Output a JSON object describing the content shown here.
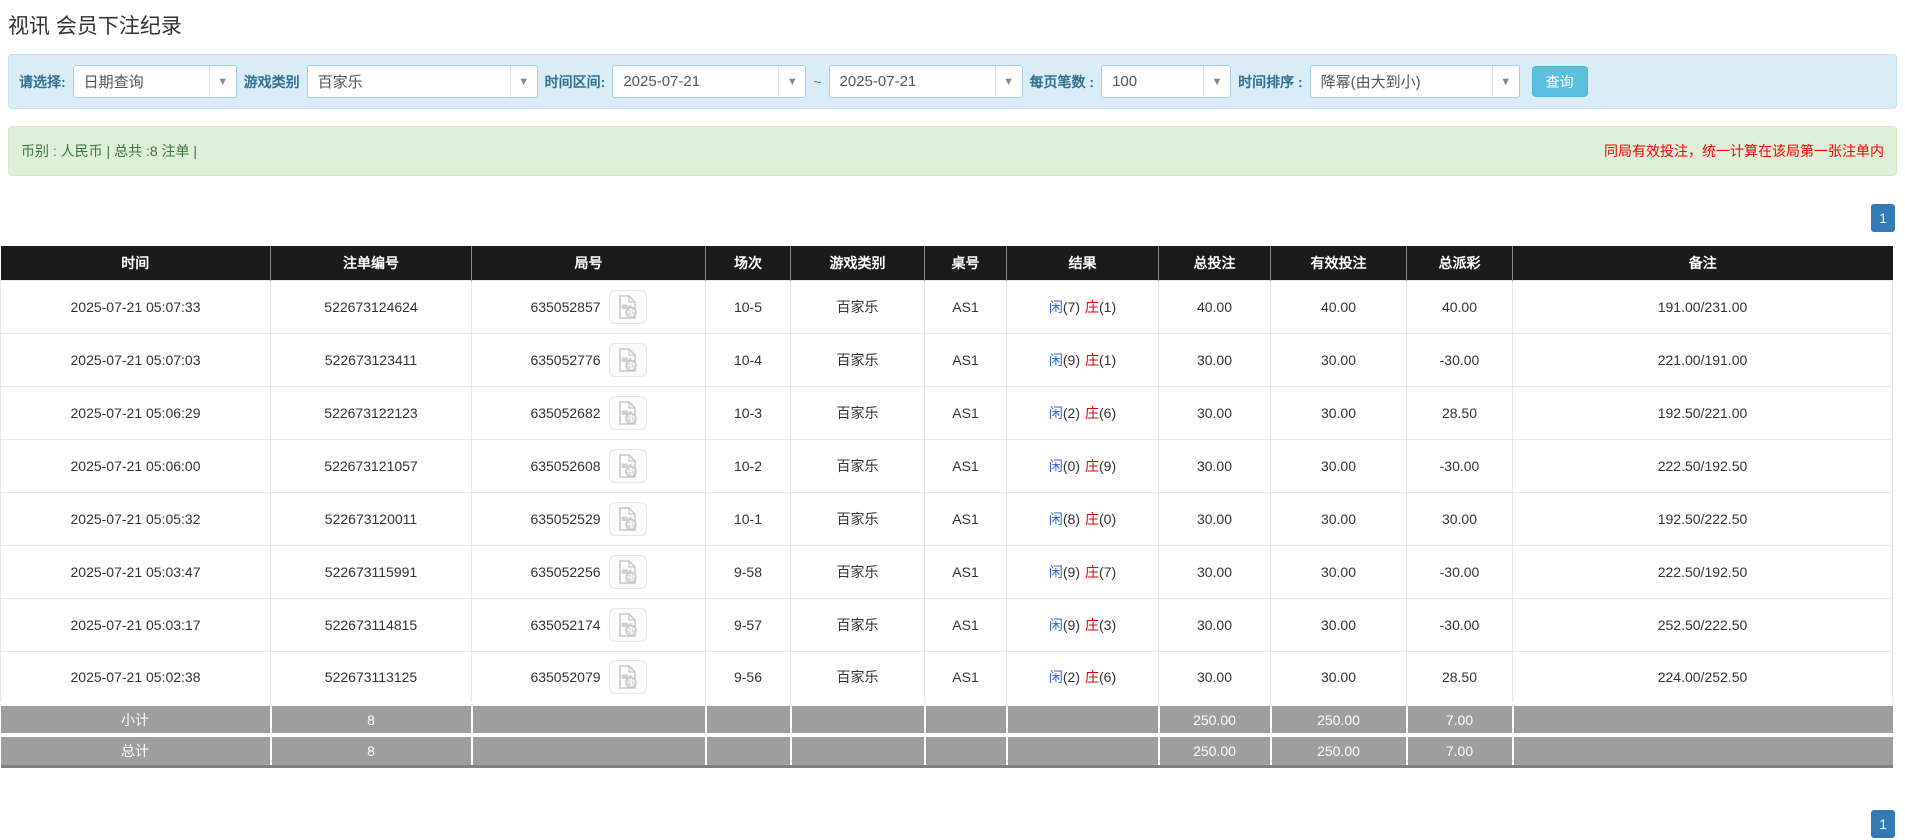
{
  "page": {
    "title": "视讯 会员下注纪录"
  },
  "filters": {
    "select_label": "请选择:",
    "select_value": "日期查询",
    "game_label": "游戏类别",
    "game_value": "百家乐",
    "range_label": "时间区间:",
    "date_from": "2025-07-21",
    "range_separator": "~",
    "date_to": "2025-07-21",
    "per_page_label": "每页笔数 :",
    "per_page_value": "100",
    "sort_label": "时间排序 :",
    "sort_value": "降幂(由大到小)",
    "search_button": "查询"
  },
  "summary": {
    "left": "币别 : 人民币 | 总共 :8 注单 |",
    "right_notice": "同局有效投注，统一计算在该局第一张注单内"
  },
  "pagination": {
    "current_page": "1"
  },
  "table": {
    "headers": [
      "时间",
      "注单编号",
      "局号",
      "场次",
      "游戏类别",
      "桌号",
      "结果",
      "总投注",
      "有效投注",
      "总派彩",
      "备注"
    ],
    "rows": [
      {
        "time": "2025-07-21 05:07:33",
        "bet_id": "522673124624",
        "round_id": "635052857",
        "session": "10-5",
        "game": "百家乐",
        "table_no": "AS1",
        "player_label": "闲",
        "player_score": "(7)",
        "banker_label": "庄",
        "banker_score": "(1)",
        "total_bet": "40.00",
        "valid_bet": "40.00",
        "payout": "40.00",
        "remark": "191.00/231.00"
      },
      {
        "time": "2025-07-21 05:07:03",
        "bet_id": "522673123411",
        "round_id": "635052776",
        "session": "10-4",
        "game": "百家乐",
        "table_no": "AS1",
        "player_label": "闲",
        "player_score": "(9)",
        "banker_label": "庄",
        "banker_score": "(1)",
        "total_bet": "30.00",
        "valid_bet": "30.00",
        "payout": "-30.00",
        "remark": "221.00/191.00"
      },
      {
        "time": "2025-07-21 05:06:29",
        "bet_id": "522673122123",
        "round_id": "635052682",
        "session": "10-3",
        "game": "百家乐",
        "table_no": "AS1",
        "player_label": "闲",
        "player_score": "(2)",
        "banker_label": "庄",
        "banker_score": "(6)",
        "total_bet": "30.00",
        "valid_bet": "30.00",
        "payout": "28.50",
        "remark": "192.50/221.00"
      },
      {
        "time": "2025-07-21 05:06:00",
        "bet_id": "522673121057",
        "round_id": "635052608",
        "session": "10-2",
        "game": "百家乐",
        "table_no": "AS1",
        "player_label": "闲",
        "player_score": "(0)",
        "banker_label": "庄",
        "banker_score": "(9)",
        "total_bet": "30.00",
        "valid_bet": "30.00",
        "payout": "-30.00",
        "remark": "222.50/192.50"
      },
      {
        "time": "2025-07-21 05:05:32",
        "bet_id": "522673120011",
        "round_id": "635052529",
        "session": "10-1",
        "game": "百家乐",
        "table_no": "AS1",
        "player_label": "闲",
        "player_score": "(8)",
        "banker_label": "庄",
        "banker_score": "(0)",
        "total_bet": "30.00",
        "valid_bet": "30.00",
        "payout": "30.00",
        "remark": "192.50/222.50"
      },
      {
        "time": "2025-07-21 05:03:47",
        "bet_id": "522673115991",
        "round_id": "635052256",
        "session": "9-58",
        "game": "百家乐",
        "table_no": "AS1",
        "player_label": "闲",
        "player_score": "(9)",
        "banker_label": "庄",
        "banker_score": "(7)",
        "total_bet": "30.00",
        "valid_bet": "30.00",
        "payout": "-30.00",
        "remark": "222.50/192.50"
      },
      {
        "time": "2025-07-21 05:03:17",
        "bet_id": "522673114815",
        "round_id": "635052174",
        "session": "9-57",
        "game": "百家乐",
        "table_no": "AS1",
        "player_label": "闲",
        "player_score": "(9)",
        "banker_label": "庄",
        "banker_score": "(3)",
        "total_bet": "30.00",
        "valid_bet": "30.00",
        "payout": "-30.00",
        "remark": "252.50/222.50"
      },
      {
        "time": "2025-07-21 05:02:38",
        "bet_id": "522673113125",
        "round_id": "635052079",
        "session": "9-56",
        "game": "百家乐",
        "table_no": "AS1",
        "player_label": "闲",
        "player_score": "(2)",
        "banker_label": "庄",
        "banker_score": "(6)",
        "total_bet": "30.00",
        "valid_bet": "30.00",
        "payout": "28.50",
        "remark": "224.00/252.50"
      }
    ],
    "subtotal": {
      "label": "小计",
      "count": "8",
      "total_bet": "250.00",
      "valid_bet": "250.00",
      "payout": "7.00"
    },
    "total": {
      "label": "总计",
      "count": "8",
      "total_bet": "250.00",
      "valid_bet": "250.00",
      "payout": "7.00"
    }
  },
  "colors": {
    "filter_bar_bg": "#d9edf7",
    "filter_label": "#31708f",
    "summary_bar_bg": "#dff0d8",
    "summary_text": "#3c763d",
    "notice_red": "#ff0000",
    "table_header_bg": "#1b1b1b",
    "link_blue": "#337ab7",
    "player_blue": "#3366cc",
    "banker_red": "#e60000",
    "negative_red": "#ff0000",
    "search_button_bg": "#5bc0de",
    "pagination_active_bg": "#337ab7",
    "footer_row_bg": "#9e9e9e"
  }
}
